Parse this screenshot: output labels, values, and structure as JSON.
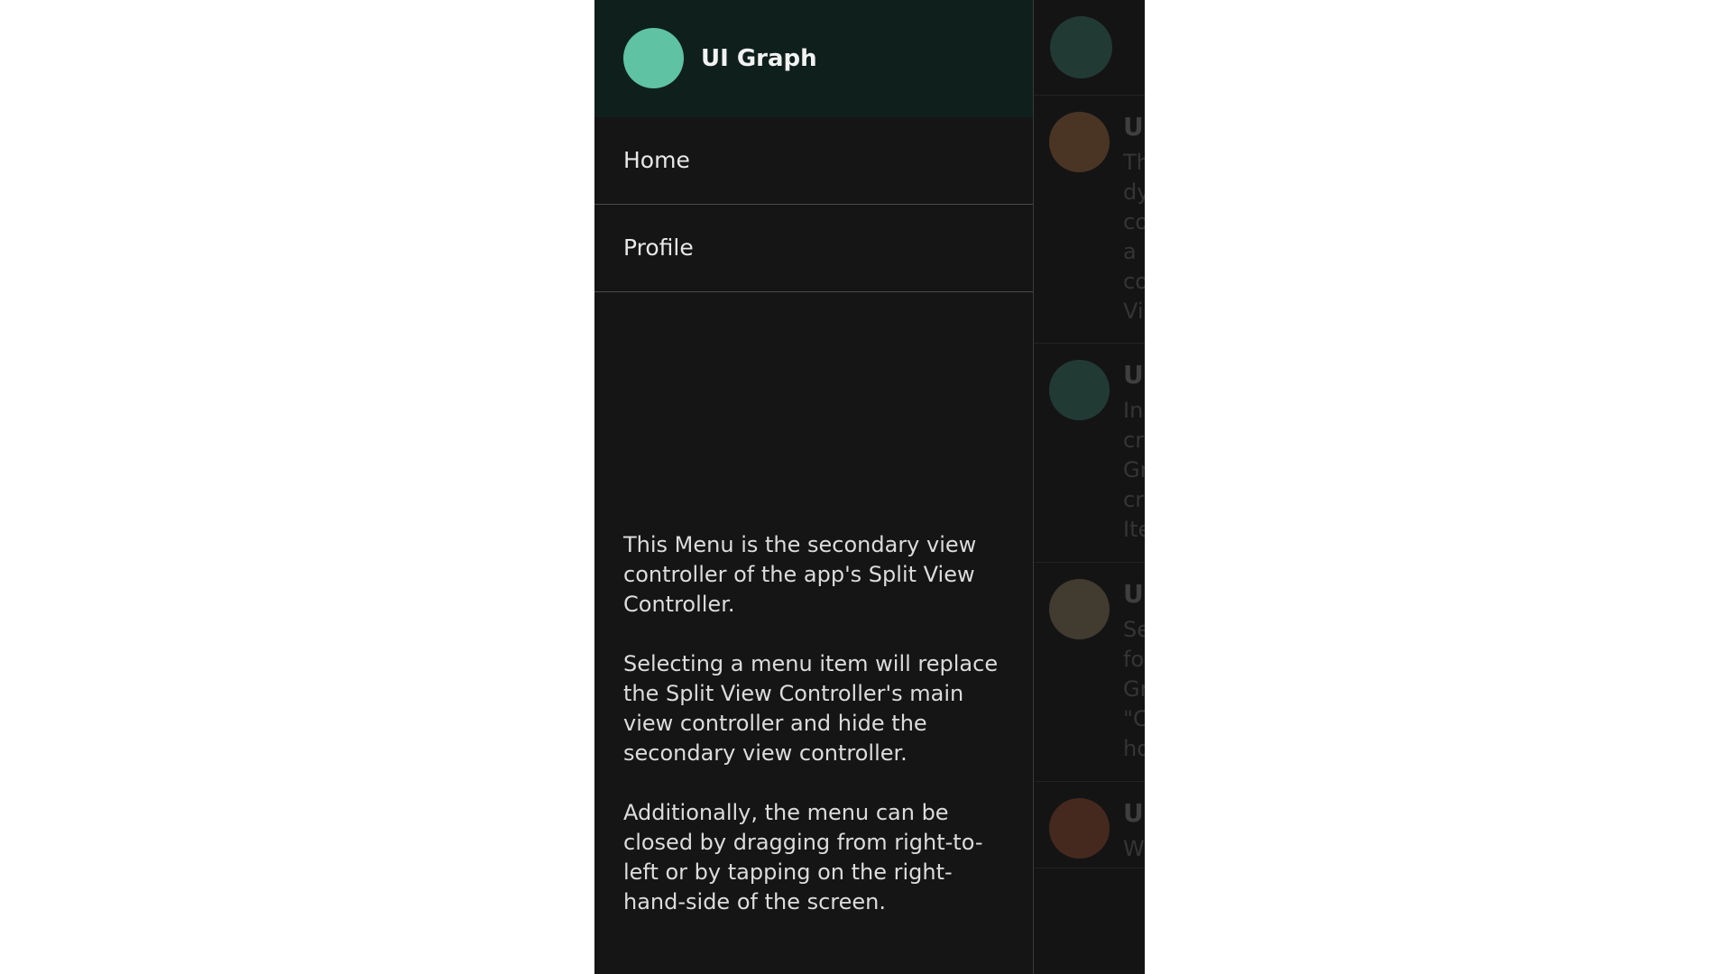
{
  "menu": {
    "title": "UI Graph",
    "avatar_color": "#5ec2a3",
    "items": [
      {
        "label": "Home"
      },
      {
        "label": "Profile"
      }
    ],
    "description": [
      "This Menu is the secondary view controller of the app's Split View Controller.",
      "Selecting a menu item will replace the Split View Controller's main view controller and hide the secondary view controller.",
      "Additionally, the menu can be closed by dragging from right-to-left or by tapping on the right-hand-side of the screen."
    ]
  },
  "main_peek": {
    "header_avatar_color": "#223a34",
    "rows": [
      {
        "title_fragment": "U",
        "body_fragment": "Th\ndy\nco\na\nco\nVi",
        "avatar_color": "#4a3525"
      },
      {
        "title_fragment": "U",
        "body_fragment": "In\ncr\nGr\ncr\nIte",
        "avatar_color": "#223a34"
      },
      {
        "title_fragment": "U",
        "body_fragment": "Se\nfo\nGr\n\"C\nho",
        "avatar_color": "#413b30"
      },
      {
        "title_fragment": "U",
        "body_fragment": "W",
        "avatar_color": "#45291f"
      }
    ]
  }
}
